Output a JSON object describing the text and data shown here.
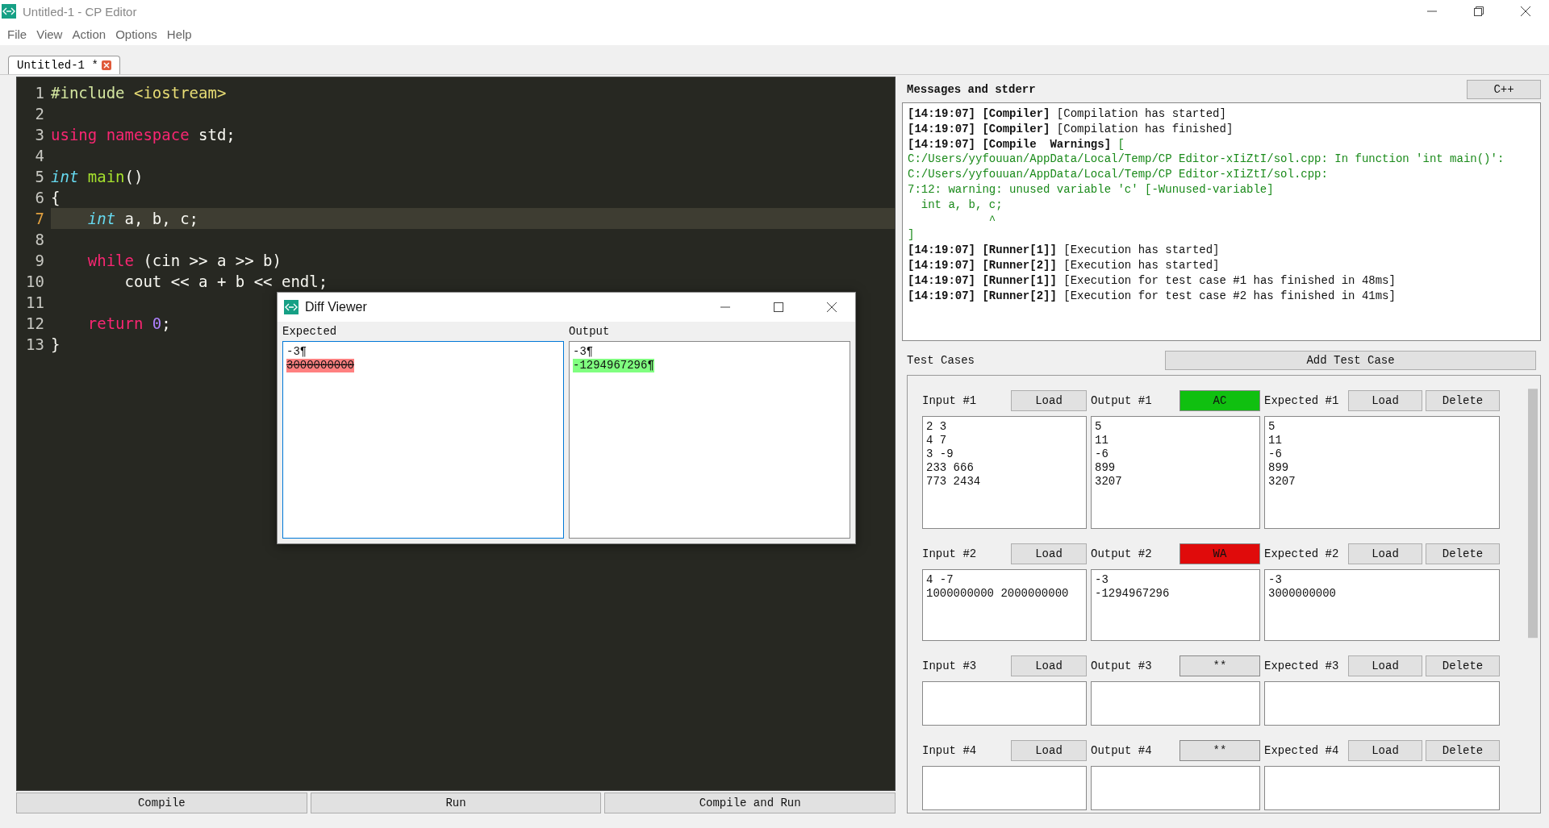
{
  "window": {
    "title": "Untitled-1 - CP Editor"
  },
  "menu": [
    "File",
    "View",
    "Action",
    "Options",
    "Help"
  ],
  "tabs": [
    {
      "label": "Untitled-1 *",
      "selected": true
    }
  ],
  "editor": {
    "lines": [
      {
        "number": "1",
        "current": false,
        "tokens": [
          {
            "text": "#include",
            "kind": "directive"
          },
          {
            "text": " <iostream>",
            "kind": "string"
          }
        ]
      },
      {
        "number": "2",
        "current": false
      },
      {
        "number": "3",
        "current": false,
        "tokens": [
          {
            "text": "using",
            "kind": "keyword"
          },
          {
            "text": " namespace",
            "kind": "keyword"
          },
          {
            "text": " std;",
            "kind": "plain"
          }
        ]
      },
      {
        "number": "4",
        "current": false
      },
      {
        "number": "5",
        "current": false,
        "tokens": [
          {
            "text": "int",
            "kind": "type"
          },
          {
            "text": " main",
            "kind": "function"
          },
          {
            "text": "()",
            "kind": "plain"
          }
        ]
      },
      {
        "number": "6",
        "current": false,
        "tokens": [
          {
            "text": "{",
            "kind": "plain"
          }
        ]
      },
      {
        "number": "7",
        "current": true,
        "tokens": [
          {
            "text": "    int",
            "kind": "type"
          },
          {
            "text": " a, b, c;",
            "kind": "plain"
          }
        ]
      },
      {
        "number": "8",
        "current": false
      },
      {
        "number": "9",
        "current": false,
        "tokens": [
          {
            "text": "    while",
            "kind": "keyword"
          },
          {
            "text": " (cin >> a >> b)",
            "kind": "plain"
          }
        ]
      },
      {
        "number": "10",
        "current": false,
        "tokens": [
          {
            "text": "        cout << a + b << endl;",
            "kind": "plain"
          }
        ]
      },
      {
        "number": "11",
        "current": false
      },
      {
        "number": "12",
        "current": false,
        "tokens": [
          {
            "text": "    return",
            "kind": "keyword"
          },
          {
            "text": " 0",
            "kind": "number"
          },
          {
            "text": ";",
            "kind": "plain"
          }
        ]
      },
      {
        "number": "13",
        "current": false,
        "tokens": [
          {
            "text": "}",
            "kind": "plain"
          }
        ]
      }
    ]
  },
  "actions": [
    "Compile",
    "Run",
    "Compile and Run"
  ],
  "messages": {
    "title": "Messages and stderr",
    "language": "C++",
    "lines": [
      {
        "kind": "log",
        "time": "[14:19:07]",
        "source": "[Compiler]",
        "text": "[Compilation has started]",
        "warning": false
      },
      {
        "kind": "log",
        "time": "[14:19:07]",
        "source": "[Compiler]",
        "text": "[Compilation has finished]",
        "warning": false
      },
      {
        "kind": "log",
        "time": "[14:19:07]",
        "source": "[Compile  Warnings]",
        "text": "[",
        "warning": true
      },
      {
        "kind": "detail",
        "text": "C:/Users/yyfouuan/AppData/Local/Temp/CP Editor-xIiZtI/sol.cpp: In function 'int main()':"
      },
      {
        "kind": "detail",
        "text": "C:/Users/yyfouuan/AppData/Local/Temp/CP Editor-xIiZtI/sol.cpp:"
      },
      {
        "kind": "detail",
        "text": "7:12: warning: unused variable 'c' [-Wunused-variable]"
      },
      {
        "kind": "detail",
        "text": "  int a, b, c;"
      },
      {
        "kind": "detail",
        "text": "            ^"
      },
      {
        "kind": "detail",
        "text": "]"
      },
      {
        "kind": "log",
        "time": "[14:19:07]",
        "source": "[Runner[1]]",
        "text": "[Execution has started]",
        "warning": false
      },
      {
        "kind": "log",
        "time": "[14:19:07]",
        "source": "[Runner[2]]",
        "text": "[Execution has started]",
        "warning": false
      },
      {
        "kind": "log",
        "time": "[14:19:07]",
        "source": "[Runner[1]]",
        "text": "[Execution for test case #1 has finished in 48ms]",
        "warning": false
      },
      {
        "kind": "log",
        "time": "[14:19:07]",
        "source": "[Runner[2]]",
        "text": "[Execution for test case #2 has finished in 41ms]",
        "warning": false
      }
    ]
  },
  "test_cases": {
    "title": "Test Cases",
    "add_button": "Add Test Case",
    "cases": [
      {
        "input_label": "Input #1",
        "input_load": "Load",
        "output_label": "Output #1",
        "verdict": "AC",
        "color": "#10c010",
        "expected_label": "Expected #1",
        "expected_load": "Load",
        "delete": "Delete",
        "input": [
          "2 3",
          "4 7",
          "3 -9",
          "233 666",
          "773 2434"
        ],
        "output": [
          "5",
          "11",
          "-6",
          "899",
          "3207"
        ],
        "expected": [
          "5",
          "11",
          "-6",
          "899",
          "3207"
        ]
      },
      {
        "input_label": "Input #2",
        "input_load": "Load",
        "output_label": "Output #2",
        "verdict": "WA",
        "color": "#e00b0b",
        "expected_label": "Expected #2",
        "expected_load": "Load",
        "delete": "Delete",
        "input": [
          "4 -7",
          "1000000000 2000000000"
        ],
        "output": [
          "-3",
          "-1294967296"
        ],
        "expected": [
          "-3",
          "3000000000"
        ]
      },
      {
        "input_label": "Input #3",
        "input_load": "Load",
        "output_label": "Output #3",
        "verdict": "**",
        "color": "#e1e1e1",
        "expected_label": "Expected #3",
        "expected_load": "Load",
        "delete": "Delete"
      },
      {
        "input_label": "Input #4",
        "input_load": "Load",
        "output_label": "Output #4",
        "verdict": "**",
        "color": "#e1e1e1",
        "expected_label": "Expected #4",
        "expected_load": "Load",
        "delete": "Delete"
      }
    ]
  },
  "diff_viewer": {
    "title": "Diff Viewer",
    "panes": [
      {
        "label": "Expected",
        "focused": true,
        "lines": [
          {
            "text": "-3¶",
            "removed": false,
            "added": false
          },
          {
            "text": "3000000000",
            "removed": true,
            "added": false
          }
        ]
      },
      {
        "label": "Output",
        "focused": false,
        "lines": [
          {
            "text": "-3¶",
            "removed": false,
            "added": false
          },
          {
            "text": "-1294967296¶",
            "removed": false,
            "added": true
          }
        ]
      }
    ]
  }
}
